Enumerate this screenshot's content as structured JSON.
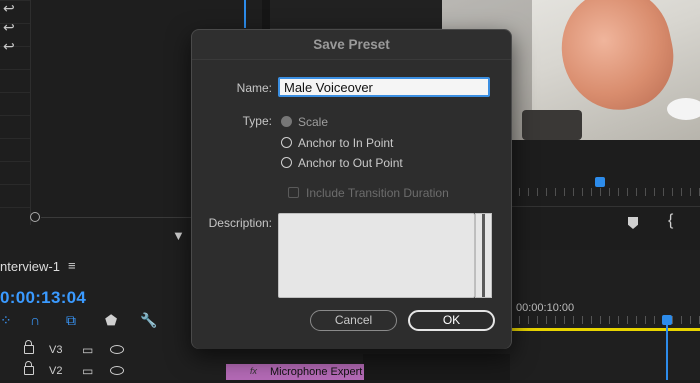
{
  "timeline": {
    "sequence_name": "nterview-1",
    "menu_glyph": "≡",
    "timecode": "0:00:13:04",
    "ruler_timecode": "00:00:10:00",
    "tracks": [
      {
        "name": "V3"
      },
      {
        "name": "V2"
      }
    ],
    "clip": {
      "fx": "fx",
      "name": "Microphone Expert"
    }
  },
  "history_icons": [
    "↩",
    "↩",
    "↩"
  ],
  "dialog": {
    "title": "Save Preset",
    "name_label": "Name:",
    "name_value": "Male Voiceover",
    "type_label": "Type:",
    "type_options": [
      {
        "label": "Scale",
        "selected": true,
        "enabled": false
      },
      {
        "label": "Anchor to In Point",
        "selected": false,
        "enabled": true
      },
      {
        "label": "Anchor to Out Point",
        "selected": false,
        "enabled": true
      }
    ],
    "include_transition_label": "Include Transition Duration",
    "include_transition_checked": false,
    "description_label": "Description:",
    "description_value": "",
    "cancel_label": "Cancel",
    "ok_label": "OK"
  },
  "colors": {
    "accent_blue": "#3a9aff",
    "focus_ring": "#3b8fe2",
    "clip_purple": "#b46ab6",
    "work_area_yellow": "#e8d400"
  },
  "icons": [
    "undo-icon",
    "filter-icon",
    "marker-icon",
    "brace-icon",
    "lock-icon",
    "film-icon",
    "eye-icon",
    "wrench-icon",
    "snap-icon",
    "magnet-icon",
    "linked-selection-icon",
    "hamburger-menu-icon"
  ]
}
